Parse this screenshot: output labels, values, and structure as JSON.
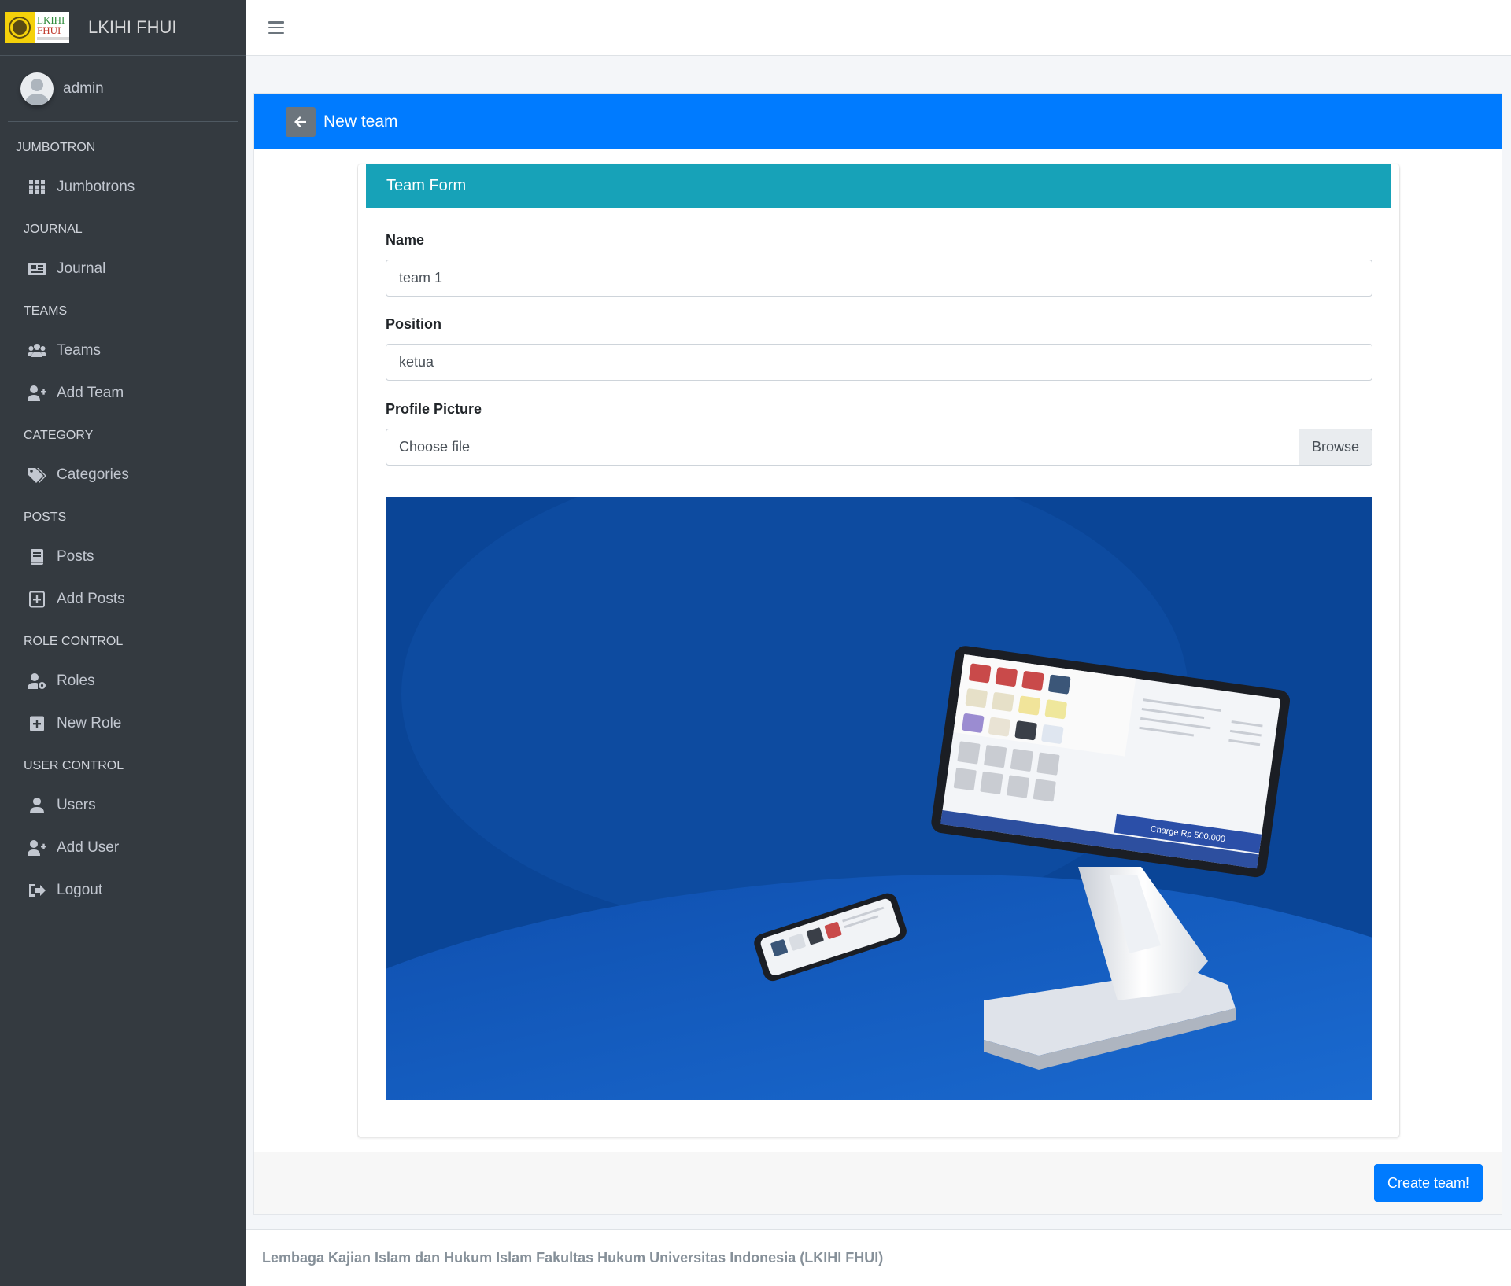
{
  "brand": {
    "name": "LKIHI FHUI",
    "logo_text_1": "LKIHI",
    "logo_text_2": "FHUI"
  },
  "user": {
    "name": "admin"
  },
  "sidebar": {
    "sections": [
      {
        "header": "JUMBOTRON",
        "items": [
          {
            "label": "Jumbotrons",
            "icon": "grid-icon"
          }
        ]
      },
      {
        "header": "JOURNAL",
        "items": [
          {
            "label": "Journal",
            "icon": "newspaper-icon"
          }
        ]
      },
      {
        "header": "TEAMS",
        "items": [
          {
            "label": "Teams",
            "icon": "users-icon"
          },
          {
            "label": "Add Team",
            "icon": "user-plus-icon"
          }
        ]
      },
      {
        "header": "CATEGORY",
        "items": [
          {
            "label": "Categories",
            "icon": "tags-icon"
          }
        ]
      },
      {
        "header": "POSTS",
        "items": [
          {
            "label": "Posts",
            "icon": "book-icon"
          },
          {
            "label": "Add Posts",
            "icon": "plus-square-icon"
          }
        ]
      },
      {
        "header": "ROLE CONTROL",
        "items": [
          {
            "label": "Roles",
            "icon": "user-cog-icon"
          },
          {
            "label": "New Role",
            "icon": "plus-square-icon"
          }
        ]
      },
      {
        "header": "USER CONTROL",
        "items": [
          {
            "label": "Users",
            "icon": "user-icon"
          },
          {
            "label": "Add User",
            "icon": "user-plus-icon"
          },
          {
            "label": "Logout",
            "icon": "sign-out-icon"
          }
        ]
      }
    ]
  },
  "page": {
    "title": "New team",
    "form_title": "Team Form",
    "fields": {
      "name": {
        "label": "Name",
        "value": "team 1"
      },
      "position": {
        "label": "Position",
        "value": "ketua"
      },
      "picture": {
        "label": "Profile Picture",
        "placeholder": "Choose file",
        "button": "Browse"
      }
    },
    "preview": {
      "screen_text": "Charge Rp 500.000"
    },
    "submit_label": "Create team!"
  },
  "footer": {
    "text": "Lembaga Kajian Islam dan Hukum Islam Fakultas Hukum Universitas Indonesia (LKIHI FHUI)"
  },
  "colors": {
    "sidebar_bg": "#343a40",
    "primary": "#007bff",
    "info": "#17a2b8"
  }
}
